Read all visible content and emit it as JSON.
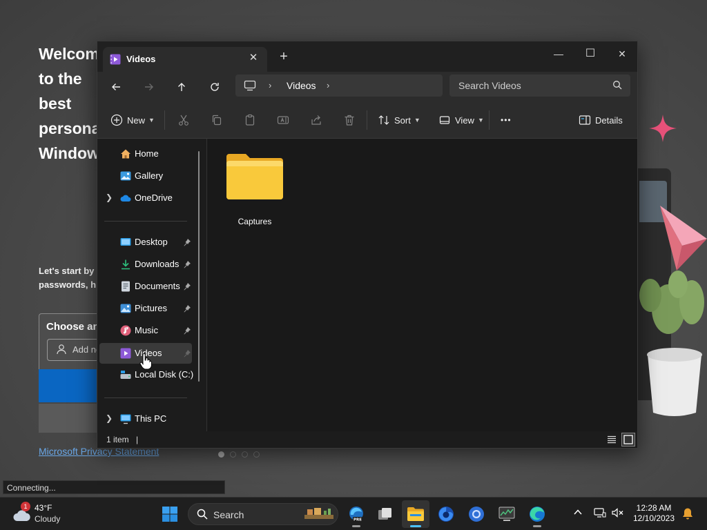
{
  "background": {
    "welcome_title": "Welcome to the\nbest personal\nWindows",
    "welcome_subtitle": "Let's start by\npasswords, hi",
    "choose_title": "Choose an",
    "add_field_label": "Add new",
    "privacy_link": "Microsoft Privacy Statement",
    "page_dots": 4,
    "active_dot": 1,
    "connecting": "Connecting..."
  },
  "explorer": {
    "tab_title": "Videos",
    "tab_close": "✕",
    "new_tab": "+",
    "window_controls": {
      "minimize": "—",
      "maximize": "☐",
      "close": "✕"
    },
    "address": {
      "root_icon": "computer-icon",
      "crumbs": [
        "Videos"
      ]
    },
    "search_placeholder": "Search Videos",
    "toolbar": {
      "new_label": "New",
      "sort_label": "Sort",
      "view_label": "View",
      "more_label": "•••",
      "details_label": "Details"
    },
    "sidebar": {
      "home": "Home",
      "gallery": "Gallery",
      "onedrive": "OneDrive",
      "desktop": "Desktop",
      "downloads": "Downloads",
      "documents": "Documents",
      "pictures": "Pictures",
      "music": "Music",
      "videos": "Videos",
      "local_disk": "Local Disk (C:)",
      "this_pc": "This PC"
    },
    "content": {
      "items": [
        {
          "name": "Captures",
          "type": "folder"
        }
      ]
    },
    "status": {
      "count": "1 item",
      "separator": "|"
    }
  },
  "taskbar": {
    "weather_temp": "43°F",
    "weather_condition": "Cloudy",
    "weather_badge": "1",
    "search_label": "Search",
    "apps": [
      "start-icon",
      "edge-beta-icon",
      "task-view-icon",
      "file-explorer-icon",
      "firefox-icon",
      "chrome-icon",
      "task-manager-icon",
      "edge-icon"
    ],
    "clock_time": "12:28 AM",
    "clock_date": "12/10/2023"
  },
  "colors": {
    "accent": "#4cc2ff",
    "folder": "#f9c93b",
    "window_bg": "#1c1c1c",
    "link": "#6aa8e8"
  }
}
